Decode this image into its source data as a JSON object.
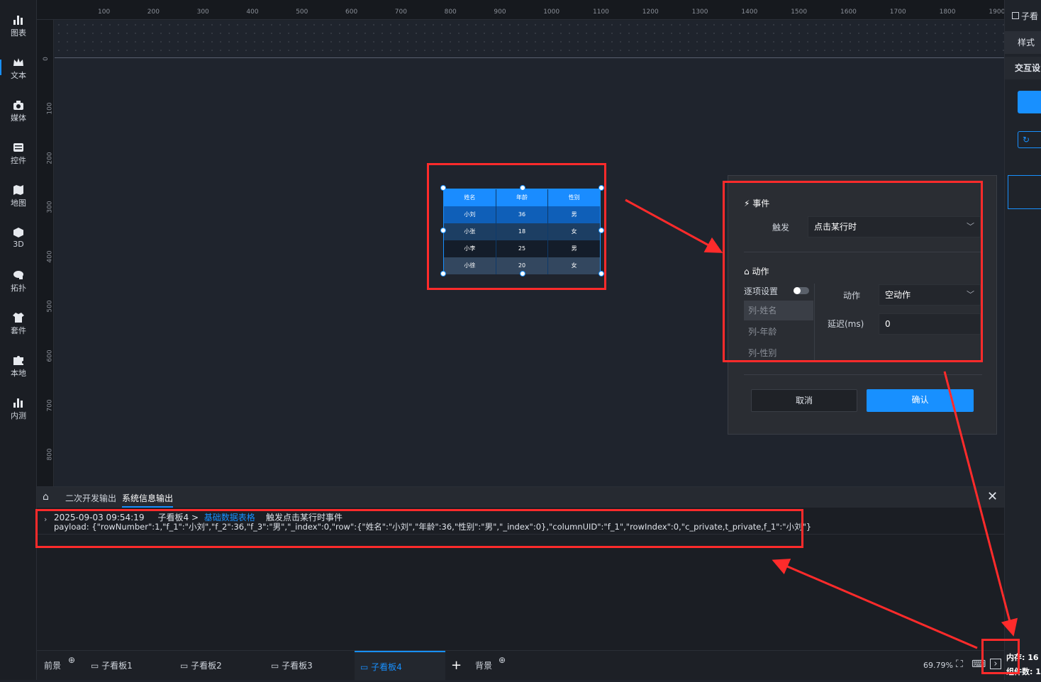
{
  "sidebar": {
    "items": [
      {
        "label": "图表"
      },
      {
        "label": "文本"
      },
      {
        "label": "媒体"
      },
      {
        "label": "控件"
      },
      {
        "label": "地图"
      },
      {
        "label": "3D"
      },
      {
        "label": "拓扑"
      },
      {
        "label": "套件"
      },
      {
        "label": "本地"
      },
      {
        "label": "内测"
      }
    ]
  },
  "ruler": {
    "top_ticks": [
      "100",
      "200",
      "300",
      "400",
      "500",
      "600",
      "700",
      "800",
      "900",
      "1000",
      "1100",
      "1200",
      "1300",
      "1400",
      "1500",
      "1600",
      "1700",
      "1800",
      "1900"
    ],
    "left_ticks": [
      "0",
      "100",
      "200",
      "300",
      "400",
      "500",
      "600",
      "700",
      "800"
    ]
  },
  "table_widget": {
    "headers": [
      "姓名",
      "年龄",
      "性别"
    ],
    "rows": [
      [
        "小刘",
        "36",
        "男"
      ],
      [
        "小张",
        "18",
        "女"
      ],
      [
        "小李",
        "25",
        "男"
      ],
      [
        "小徐",
        "20",
        "女"
      ]
    ]
  },
  "right_panel": {
    "title": "子看",
    "tab_style": "样式",
    "tab_interaction": "交互设"
  },
  "dialog": {
    "event_section": "事件",
    "trigger_label": "触发",
    "trigger_value": "点击某行时",
    "action_section": "动作",
    "per_item_label": "逐项设置",
    "columns": [
      "列-姓名",
      "列-年龄",
      "列-性别"
    ],
    "action_label": "动作",
    "action_value": "空动作",
    "delay_label": "延迟(ms)",
    "delay_value": "0",
    "cancel": "取消",
    "confirm": "确认"
  },
  "console": {
    "tabs": [
      "二次开发输出",
      "系统信息输出"
    ],
    "log_time": "2025-09-03 09:54:19",
    "log_board": "子看板4 >",
    "log_component": "基础数据表格",
    "log_event": "触发点击某行时事件",
    "log_payload": "payload: {\"rowNumber\":1,\"f_1\":\"小刘\",\"f_2\":36,\"f_3\":\"男\",\"_index\":0,\"row\":{\"姓名\":\"小刘\",\"年龄\":36,\"性别\":\"男\",\"_index\":0},\"columnUID\":\"f_1\",\"rowIndex\":0,\"c_private,t_private,f_1\":\"小刘\"}"
  },
  "bottombar": {
    "foreground": "前景",
    "boards": [
      "子看板1",
      "子看板2",
      "子看板3",
      "子看板4"
    ],
    "active_board": "子看板4",
    "add": "+",
    "background": "背景",
    "zoom": "69.79%",
    "memory": "内存: 16",
    "component_count": "组件数: 1"
  },
  "colors": {
    "accent": "#1890ff",
    "annotation": "#ff2b2b"
  }
}
